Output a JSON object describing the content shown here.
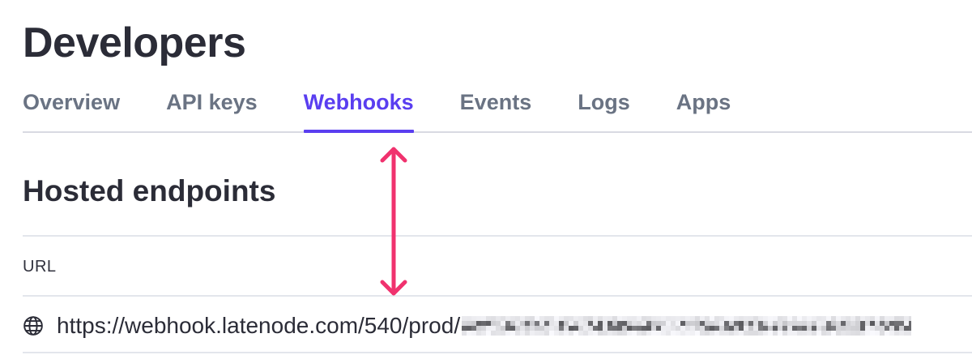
{
  "page": {
    "title": "Developers"
  },
  "tabs": [
    {
      "label": "Overview",
      "active": false
    },
    {
      "label": "API keys",
      "active": false
    },
    {
      "label": "Webhooks",
      "active": true
    },
    {
      "label": "Events",
      "active": false
    },
    {
      "label": "Logs",
      "active": false
    },
    {
      "label": "Apps",
      "active": false
    }
  ],
  "section": {
    "title": "Hosted endpoints"
  },
  "table": {
    "column_header": "URL",
    "rows": [
      {
        "icon": "globe-icon",
        "url": "https://webhook.latenode.com/540/prod/",
        "url_suffix_redacted": true
      }
    ]
  },
  "annotation": {
    "icon": "double-headed-arrow-icon",
    "color": "#f0326e"
  },
  "colors": {
    "accent": "#5a3ef0",
    "text": "#2b2c37",
    "muted": "#6a7383",
    "annotation": "#f0326e"
  }
}
